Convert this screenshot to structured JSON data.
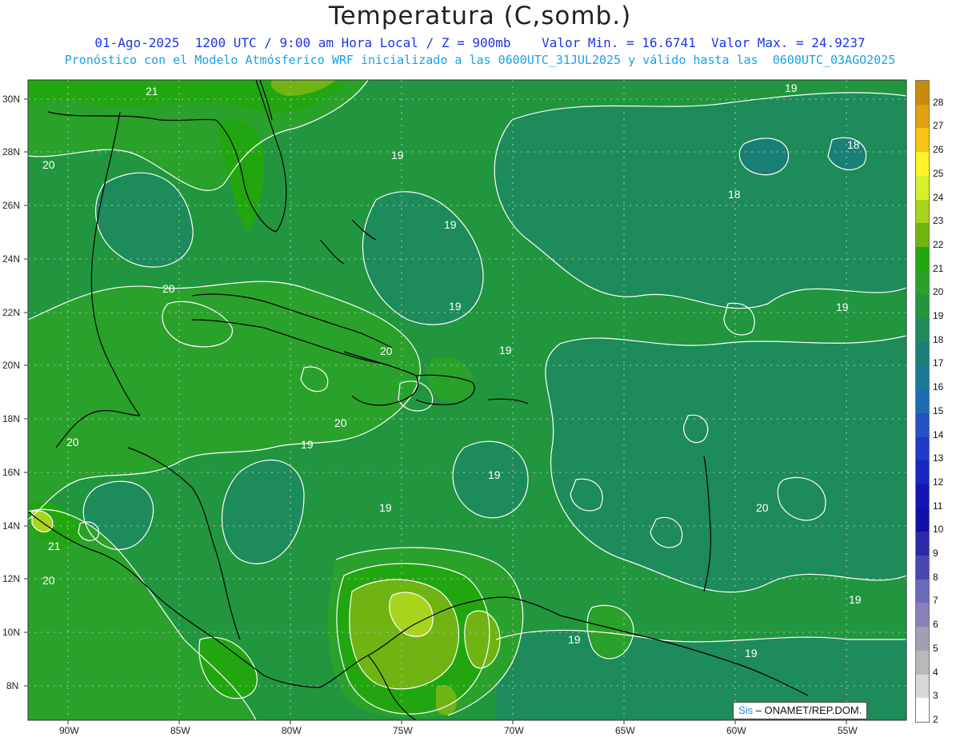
{
  "header": {
    "title": "Temperatura (C,somb.)",
    "line1": "01-Ago-2025  1200 UTC / 9:00 am Hora Local / Z = 900mb    Valor Min. = 16.6741  Valor Max. = 24.9237",
    "line2": "Pronóstico con el Modelo Atmósferico WRF inicializado a las 0600UTC_31JUL2025 y válido hasta las  0600UTC_03AGO2025"
  },
  "map": {
    "lat_labels": [
      "30N",
      "28N",
      "26N",
      "24N",
      "22N",
      "20N",
      "18N",
      "16N",
      "14N",
      "12N",
      "10N",
      "8N"
    ],
    "lon_labels": [
      "90W",
      "85W",
      "80W",
      "75W",
      "70W",
      "65W",
      "60W",
      "55W"
    ],
    "contour_labels": [
      "21",
      "20",
      "19",
      "19",
      "18",
      "18",
      "19",
      "19",
      "20",
      "19",
      "20",
      "20",
      "19",
      "20",
      "19",
      "19",
      "19",
      "20",
      "21",
      "20",
      "19",
      "19",
      "19"
    ],
    "credit_part1": "Sis",
    "credit_part2": " – ONAMET/REP.DOM."
  },
  "colorbar": {
    "levels": [
      "28",
      "27",
      "26",
      "25",
      "24",
      "23",
      "22",
      "21",
      "20",
      "19",
      "18",
      "17",
      "16",
      "15",
      "14",
      "13",
      "12",
      "11",
      "10",
      "9",
      "8",
      "7",
      "6",
      "5",
      "4",
      "3",
      "2"
    ],
    "colors": [
      "#c88a0a",
      "#e3a20d",
      "#f7c512",
      "#fff32a",
      "#d6f02a",
      "#a7d41c",
      "#6fb413",
      "#22a610",
      "#2aa12a",
      "#21963e",
      "#1d8b5a",
      "#1a7f74",
      "#1b7896",
      "#1f6ab5",
      "#2650c3",
      "#1f3ac6",
      "#1a26c0",
      "#1414b8",
      "#1010a8",
      "#2a2aa8",
      "#4848b0",
      "#6a6ab8",
      "#8a80b8",
      "#a0a0b0",
      "#b8b8b8",
      "#d8d8d8",
      "#ffffff"
    ]
  }
}
